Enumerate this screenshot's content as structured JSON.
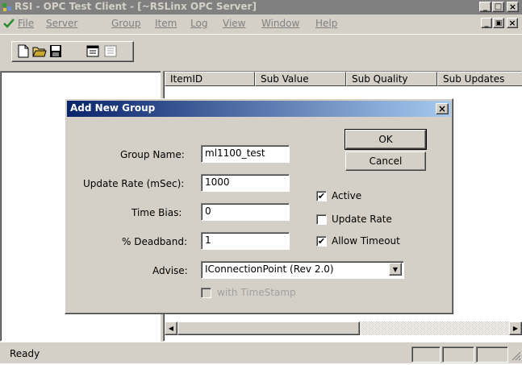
{
  "window": {
    "title": "RSI - OPC Test Client - [~RSLinx OPC Server]",
    "caption_controls": {
      "min": "_",
      "restore": "□",
      "close": "×"
    },
    "mdi_controls": {
      "min": "_",
      "restore": "▣",
      "close": "×"
    }
  },
  "menu": {
    "items": [
      {
        "label": "File"
      },
      {
        "label": "Server"
      },
      {
        "label": "Group"
      },
      {
        "label": "Item"
      },
      {
        "label": "Log"
      },
      {
        "label": "View"
      },
      {
        "label": "Window"
      },
      {
        "label": "Help"
      }
    ]
  },
  "list": {
    "columns": [
      "ItemID",
      "Sub Value",
      "Sub Quality",
      "Sub Updates"
    ]
  },
  "status": {
    "text": "Ready"
  },
  "dialog": {
    "title": "Add New Group",
    "close": "×",
    "ok_label": "OK",
    "cancel_label": "Cancel",
    "group_name_label": "Group Name:",
    "group_name_value": "ml1100_test",
    "update_rate_label": "Update Rate (mSec):",
    "update_rate_value": "1000",
    "time_bias_label": "Time Bias:",
    "time_bias_value": "0",
    "deadband_label": "% Deadband:",
    "deadband_value": "1",
    "advise_label": "Advise:",
    "advise_value": "IConnectionPoint (Rev 2.0)",
    "active_label": "Active",
    "active_checked": true,
    "update_rate_cb_label": "Update Rate",
    "update_rate_cb_checked": false,
    "allow_timeout_label": "Allow Timeout",
    "allow_timeout_checked": true,
    "with_timestamp_label": "with TimeStamp",
    "with_timestamp_checked": false,
    "check_glyph": "✔"
  }
}
